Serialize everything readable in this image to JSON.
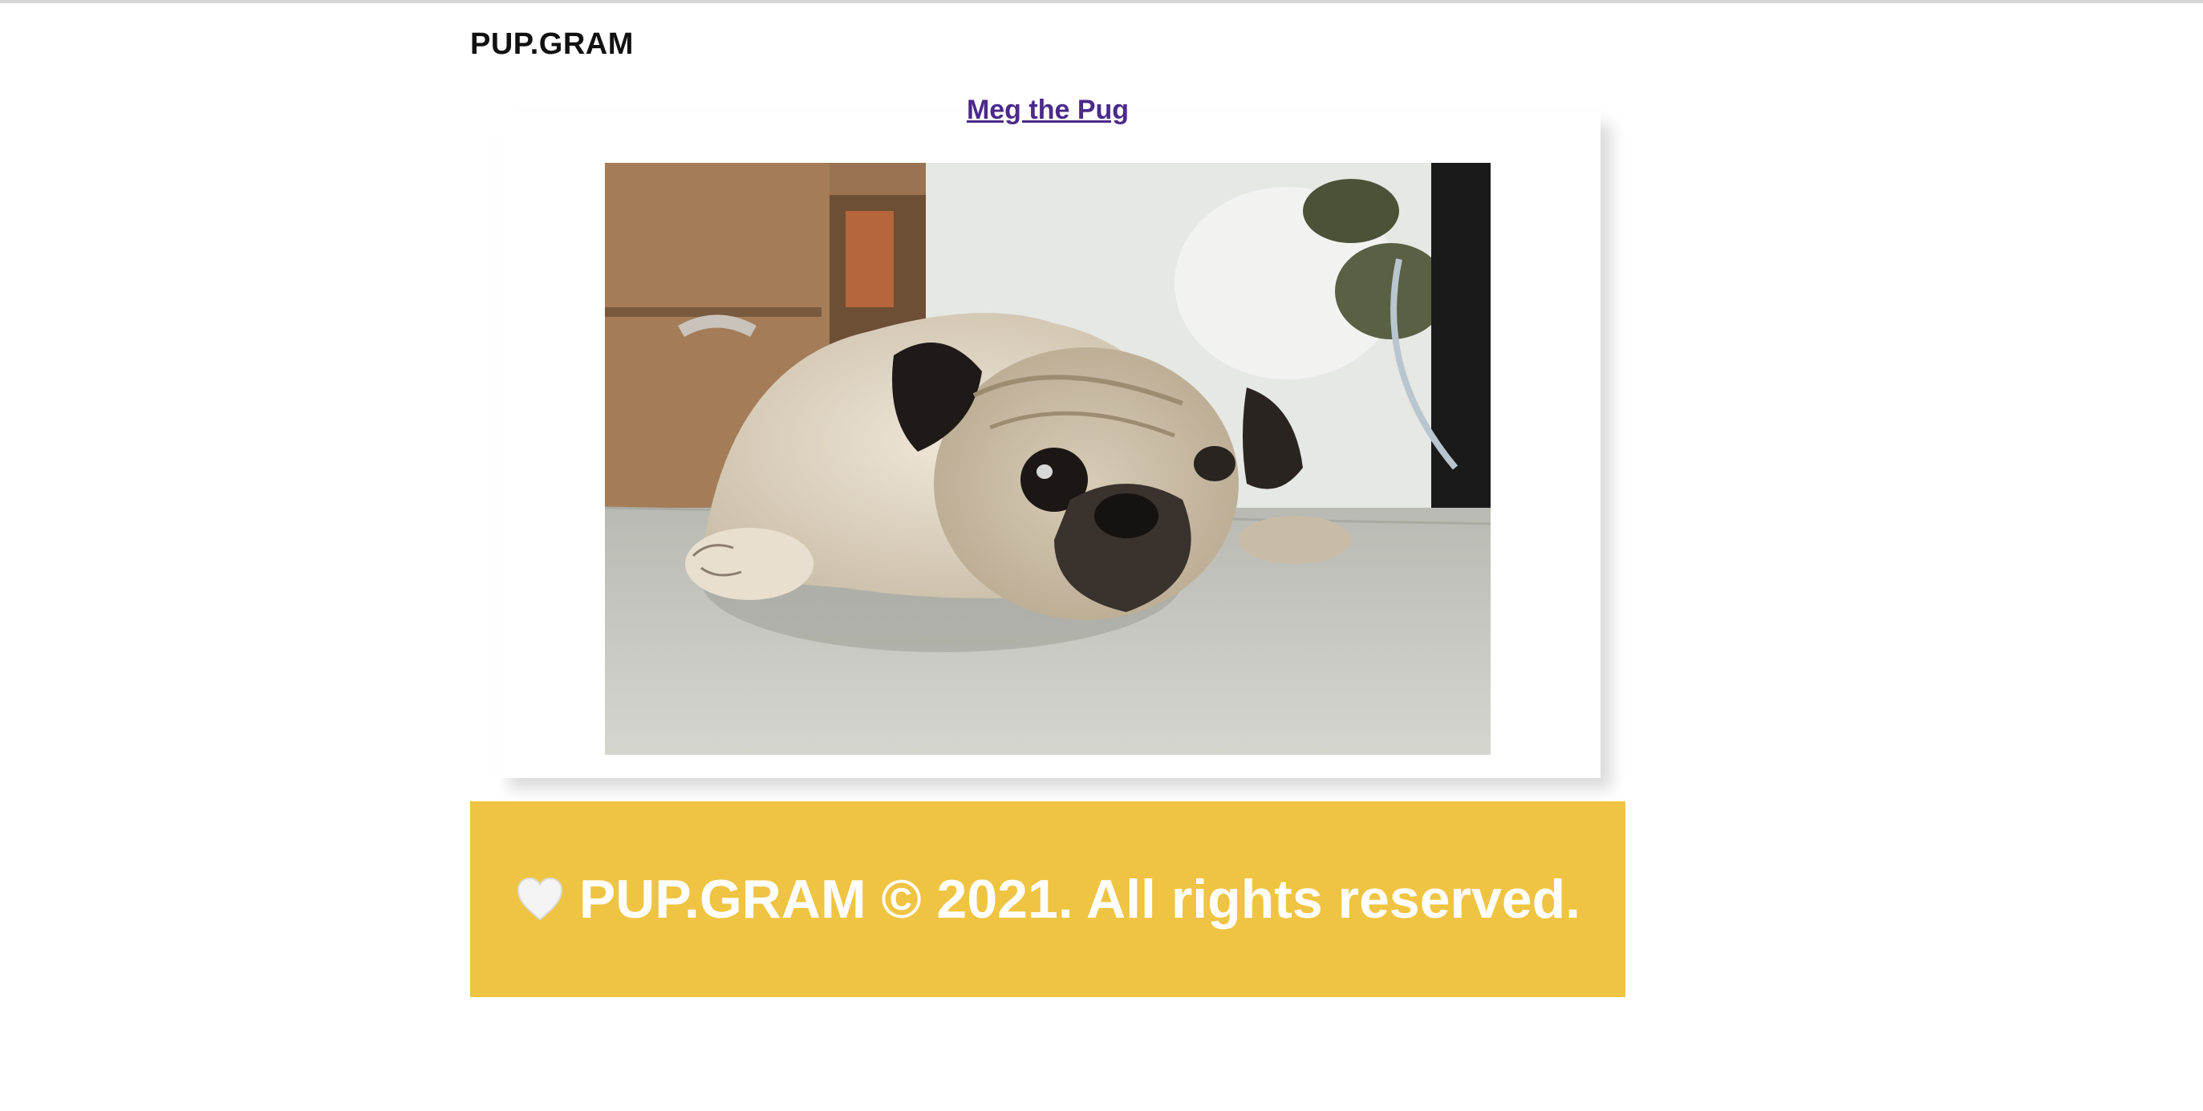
{
  "header": {
    "brand": "PUP.GRAM"
  },
  "post": {
    "title": "Meg the Pug",
    "image_subject": "pug lying on floor"
  },
  "footer": {
    "icon": "white-heart-icon",
    "text": "PUP.GRAM © 2021. All rights reserved."
  },
  "colors": {
    "footer_bg": "#efc442",
    "link": "#4b2a8a",
    "text_dark": "#111111"
  }
}
